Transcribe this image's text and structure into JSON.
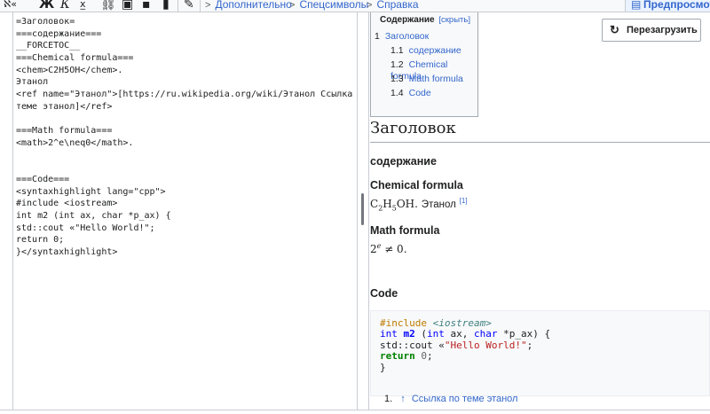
{
  "toolbar": {
    "menus": [
      "Дополнительно",
      "Спецсимволы",
      "Справка"
    ],
    "preview_label": "Предпросмотр"
  },
  "editor": {
    "lines": [
      "=Заголовок=",
      "===содержание===",
      "__FORCETOC__",
      "===Chemical formula===",
      "<chem>C2H5OH</chem>.",
      "Этанол",
      "<ref name=\"Этанол\">[https://ru.wikipedia.org/wiki/Этанол Ссылка по",
      "теме этанол]</ref>",
      "",
      "===Math formula===",
      "<math>2^e\\neq0</math>.",
      "",
      "",
      "===Code===",
      "<syntaxhighlight lang=\"cpp\">",
      "#include <iostream>",
      "int m2 (int ax, char *p_ax) {",
      "std::cout «\"Hello World!\";",
      "return 0;",
      "}</syntaxhighlight>"
    ]
  },
  "toc": {
    "title": "Содержание",
    "toggle": "[скрыть]",
    "items": [
      {
        "num": "1",
        "text": "Заголовок"
      },
      {
        "num": "1.1",
        "text": "содержание"
      },
      {
        "num": "1.2",
        "text": "Chemical formula"
      },
      {
        "num": "1.3",
        "text": "Math formula"
      },
      {
        "num": "1.4",
        "text": "Code"
      }
    ]
  },
  "reload_label": "Перезагрузить",
  "preview": {
    "h1": "Заголовок",
    "h_contents": "содержание",
    "h_chem": "Chemical formula",
    "chem_text": "Этанол",
    "ref_mark": "[1]",
    "h_math": "Math formula",
    "h_code": "Code",
    "ref_num": "1.",
    "ref_arrow": "↑",
    "ref_text": "Ссылка по теме этанол"
  }
}
